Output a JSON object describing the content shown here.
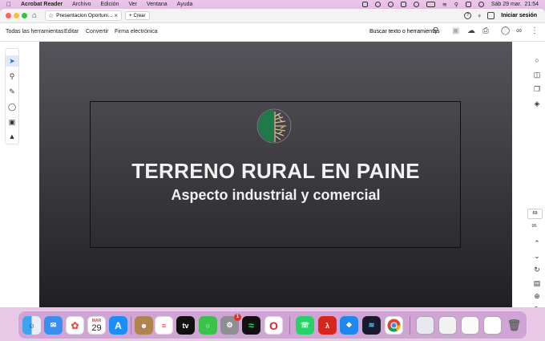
{
  "menubar": {
    "app_name": "Acrobat Reader",
    "items": [
      "Archivo",
      "Edición",
      "Ver",
      "Ventana",
      "Ayuda"
    ],
    "clock": "Sáb 29 mar.  21:54"
  },
  "titlebar": {
    "tab_title": "Presentacion Oportuni...",
    "create_label": "Crear",
    "sign_in_label": "Iniciar sesión"
  },
  "toolbar": {
    "menus": [
      "Todas las herramientas",
      "Editar",
      "Convertir",
      "Firma electrónica"
    ],
    "search_label": "Buscar texto o herramientas"
  },
  "slide": {
    "title": "TERRENO RURAL EN PAINE",
    "subtitle": "Aspecto industrial y comercial"
  },
  "page_nav": {
    "current_page": "69",
    "total_pages": "95"
  },
  "dock": {
    "calendar_month": "MAR",
    "calendar_day": "29",
    "tv_label": "tv",
    "settings_badge": "1"
  },
  "colors": {
    "accent": "#1473e6",
    "slide_bg_top": "#54545a",
    "slide_bg_bottom": "#202024",
    "menubar_bg": "#e9c7e6"
  }
}
